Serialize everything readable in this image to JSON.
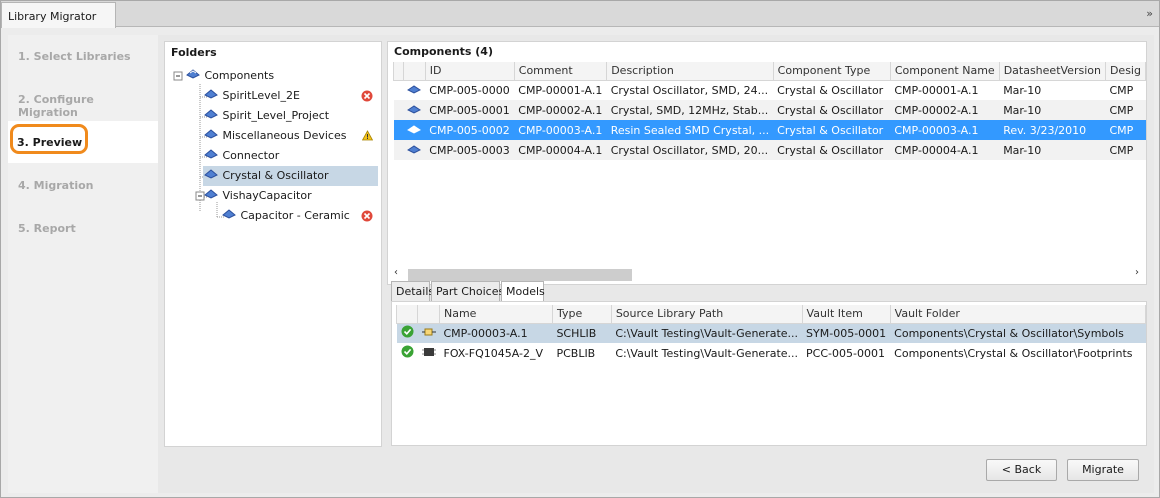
{
  "window": {
    "title": "Library Migrator",
    "menu_icon": "double-chevron-icon"
  },
  "steps": [
    {
      "label": "1. Select Libraries",
      "active": false
    },
    {
      "label": "2. Configure Migration",
      "active": false
    },
    {
      "label": "3. Preview",
      "active": true
    },
    {
      "label": "4. Migration",
      "active": false
    },
    {
      "label": "5. Report",
      "active": false
    }
  ],
  "folders": {
    "title": "Folders",
    "root": "Components",
    "items": [
      {
        "label": "SpiritLevel_2E",
        "status": "error"
      },
      {
        "label": "Spirit_Level_Project",
        "status": ""
      },
      {
        "label": "Miscellaneous Devices",
        "status": "warning"
      },
      {
        "label": "Connector",
        "status": ""
      },
      {
        "label": "Crystal & Oscillator",
        "status": "",
        "selected": true
      },
      {
        "label": "VishayCapacitor",
        "status": ""
      },
      {
        "label": "Capacitor - Ceramic",
        "status": "error"
      }
    ]
  },
  "components": {
    "title": "Components (4)",
    "columns": [
      "ID",
      "Comment",
      "Description",
      "Component Type",
      "Component Name",
      "DatasheetVersion",
      "Desig"
    ],
    "rows": [
      [
        "CMP-005-0000",
        "CMP-00001-A.1",
        "Crystal Oscillator, SMD, 24...",
        "Crystal & Oscillator",
        "CMP-00001-A.1",
        "Mar-10",
        "CMP"
      ],
      [
        "CMP-005-0001",
        "CMP-00002-A.1",
        "Crystal, SMD, 12MHz, Stab...",
        "Crystal & Oscillator",
        "CMP-00002-A.1",
        "Mar-10",
        "CMP"
      ],
      [
        "CMP-005-0002",
        "CMP-00003-A.1",
        "Resin Sealed SMD Crystal, ...",
        "Crystal & Oscillator",
        "CMP-00003-A.1",
        "Rev. 3/23/2010",
        "CMP"
      ],
      [
        "CMP-005-0003",
        "CMP-00004-A.1",
        "Crystal Oscillator, SMD, 20...",
        "Crystal & Oscillator",
        "CMP-00004-A.1",
        "Mar-10",
        "CMP"
      ]
    ],
    "selected_row": 2
  },
  "tabs": [
    {
      "label": "Details",
      "active": false
    },
    {
      "label": "Part Choices",
      "active": false
    },
    {
      "label": "Models",
      "active": true
    }
  ],
  "models": {
    "columns": [
      "Name",
      "Type",
      "Source Library Path",
      "Vault Item",
      "Vault Folder"
    ],
    "rows": [
      [
        "CMP-00003-A.1",
        "SCHLIB",
        "C:\\Vault Testing\\Vault-Generate...",
        "SYM-005-0001",
        "Components\\Crystal & Oscillator\\Symbols"
      ],
      [
        "FOX-FQ1045A-2_V",
        "PCBLIB",
        "C:\\Vault Testing\\Vault-Generate...",
        "PCC-005-0001",
        "Components\\Crystal & Oscillator\\Footprints"
      ]
    ]
  },
  "buttons": {
    "back": "< Back",
    "migrate": "Migrate"
  },
  "colors": {
    "highlight": "#f08a1c",
    "selection": "#3399ff",
    "tree_selection": "#c7d7e5"
  }
}
